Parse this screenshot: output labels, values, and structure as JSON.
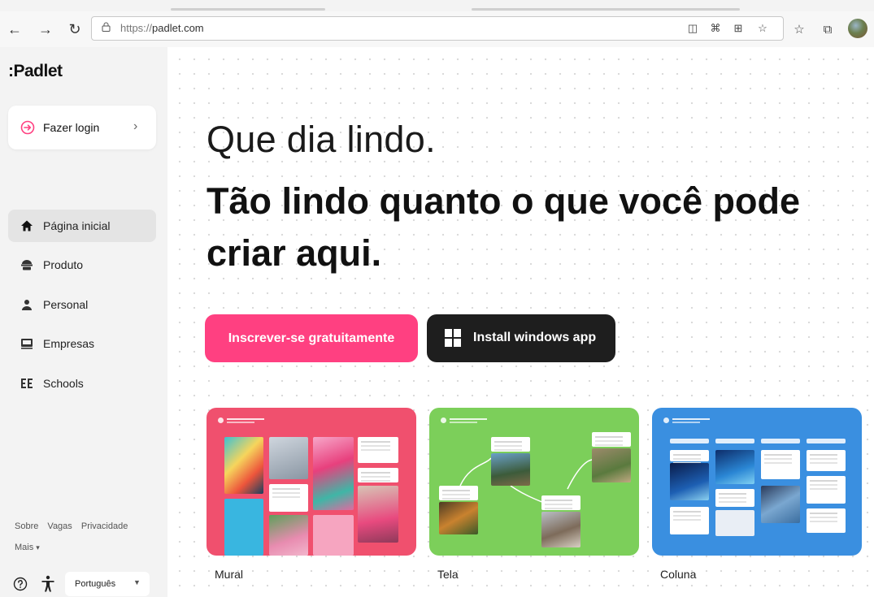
{
  "browser": {
    "url_protocol": "https://",
    "url_host": "padlet.com"
  },
  "sidebar": {
    "logo": ":Padlet",
    "login_label": "Fazer login",
    "nav": [
      {
        "label": "Página inicial",
        "icon": "home-icon",
        "active": true
      },
      {
        "label": "Produto",
        "icon": "product-icon",
        "active": false
      },
      {
        "label": "Personal",
        "icon": "person-icon",
        "active": false
      },
      {
        "label": "Empresas",
        "icon": "business-icon",
        "active": false
      },
      {
        "label": "Schools",
        "icon": "schools-icon",
        "active": false
      }
    ],
    "footer_links": [
      "Sobre",
      "Vagas",
      "Privacidade"
    ],
    "more_label": "Mais",
    "language": "Português"
  },
  "hero": {
    "line1": "Que dia lindo.",
    "line2": "Tão lindo quanto o que você pode criar aqui."
  },
  "buttons": {
    "signup": "Inscrever-se gratuitamente",
    "install": "Install windows app"
  },
  "templates": [
    {
      "label": "Mural",
      "color": "#f0506e"
    },
    {
      "label": "Tela",
      "color": "#7ccf5a"
    },
    {
      "label": "Coluna",
      "color": "#3a8fe0"
    }
  ],
  "colors": {
    "brand_pink": "#ff4081",
    "dark_button": "#1e1e1e",
    "login_icon": "#ff4081"
  }
}
